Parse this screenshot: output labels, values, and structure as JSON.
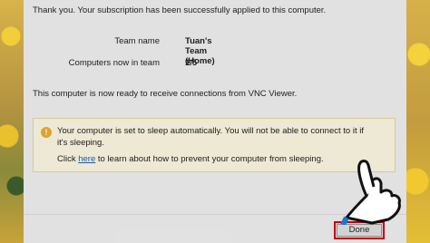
{
  "intro": "Thank you. Your subscription has been successfully applied to this computer.",
  "details": [
    {
      "label": "Team name",
      "value": "Tuan's Team (Home)"
    },
    {
      "label": "Computers now in team",
      "value": "1/5"
    }
  ],
  "ready_text": "This computer is now ready to receive connections from VNC Viewer.",
  "warning": {
    "icon": "!",
    "text": "Your computer is set to sleep automatically. You will not be able to connect to it if it's sleeping.",
    "link_prefix": "Click ",
    "link_text": "here",
    "link_suffix": " to learn about how to prevent your computer from sleeping."
  },
  "done_label": "Done",
  "colors": {
    "highlight": "#d0021b",
    "warning_bg": "#fcf8e3",
    "link": "#1a5fb4"
  }
}
